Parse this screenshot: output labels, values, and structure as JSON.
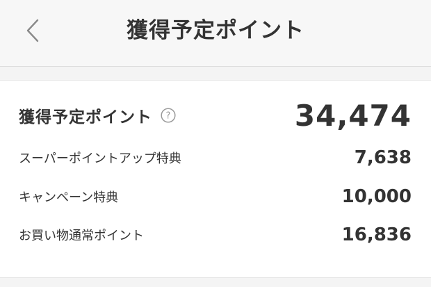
{
  "header": {
    "title": "獲得予定ポイント",
    "back_icon": "chevron-left-icon"
  },
  "summary": {
    "label": "獲得予定ポイント",
    "help_icon": "question-circle-icon",
    "total": "34,474"
  },
  "breakdown": [
    {
      "label": "スーパーポイントアップ特典",
      "value": "7,638"
    },
    {
      "label": "キャンペーン特典",
      "value": "10,000"
    },
    {
      "label": "お買い物通常ポイント",
      "value": "16,836"
    }
  ]
}
